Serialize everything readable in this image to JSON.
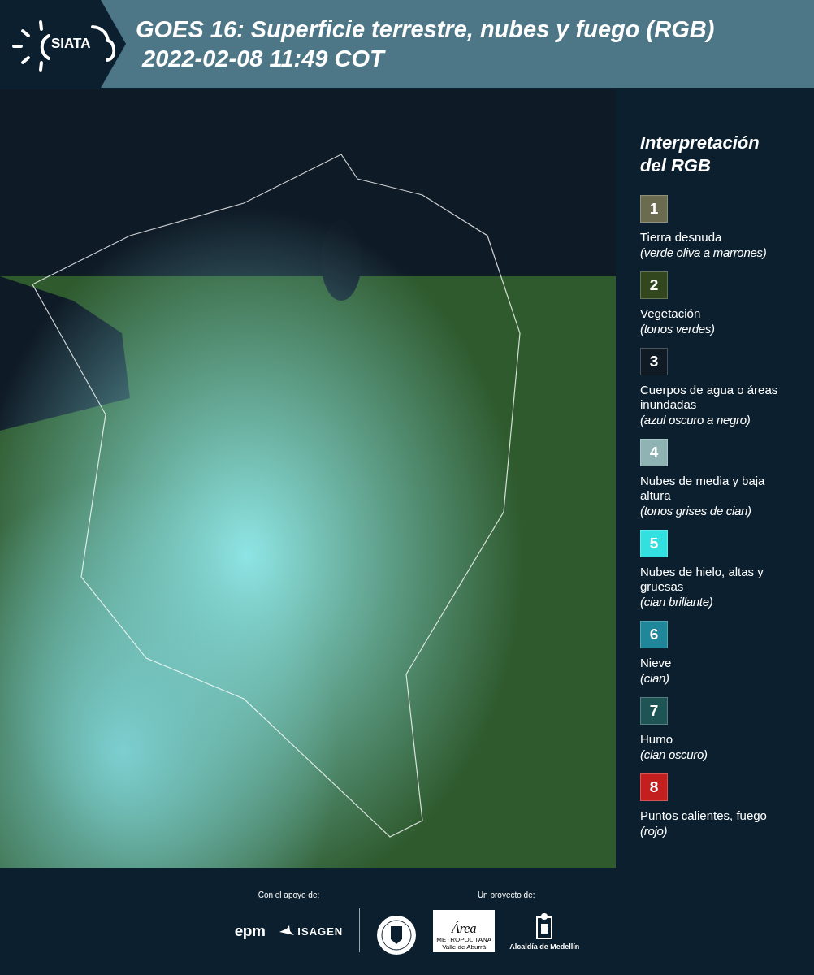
{
  "header": {
    "logo_text": "SIATA",
    "title": "GOES 16: Superficie terrestre, nubes y fuego (RGB)",
    "timestamp": " 2022-02-08 11:49 COT"
  },
  "legend": {
    "title": "Interpretación del RGB",
    "items": [
      {
        "number": "1",
        "color": "#6b6b4f",
        "label": "Tierra desnuda",
        "description": "(verde oliva a marrones)"
      },
      {
        "number": "2",
        "color": "#33471f",
        "label": "Vegetación",
        "description": "(tonos verdes)"
      },
      {
        "number": "3",
        "color": "#0f1a24",
        "label": "Cuerpos de agua o áreas inundadas",
        "description": "(azul oscuro a negro)"
      },
      {
        "number": "4",
        "color": "#8fb3b3",
        "label": "Nubes de media y baja altura",
        "description": "(tonos grises de cian)"
      },
      {
        "number": "5",
        "color": "#33e0e0",
        "label": "Nubes de hielo, altas y gruesas",
        "description": "(cian brillante)"
      },
      {
        "number": "6",
        "color": "#1f8799",
        "label": "Nieve",
        "description": "(cian)"
      },
      {
        "number": "7",
        "color": "#1f5454",
        "label": "Humo",
        "description": "(cian oscuro)"
      },
      {
        "number": "8",
        "color": "#c41f1f",
        "label": "Puntos calientes, fuego",
        "description": "(rojo)"
      }
    ]
  },
  "footer": {
    "support_label": "Con el apoyo de:",
    "project_label": "Un proyecto de:",
    "epm": "epm",
    "isagen": "ISAGEN",
    "area": "Área",
    "area_sub": "METROPOLITANA",
    "area_sub2": "Valle de Aburrá",
    "alcaldia": "Alcaldía de Medellín"
  }
}
